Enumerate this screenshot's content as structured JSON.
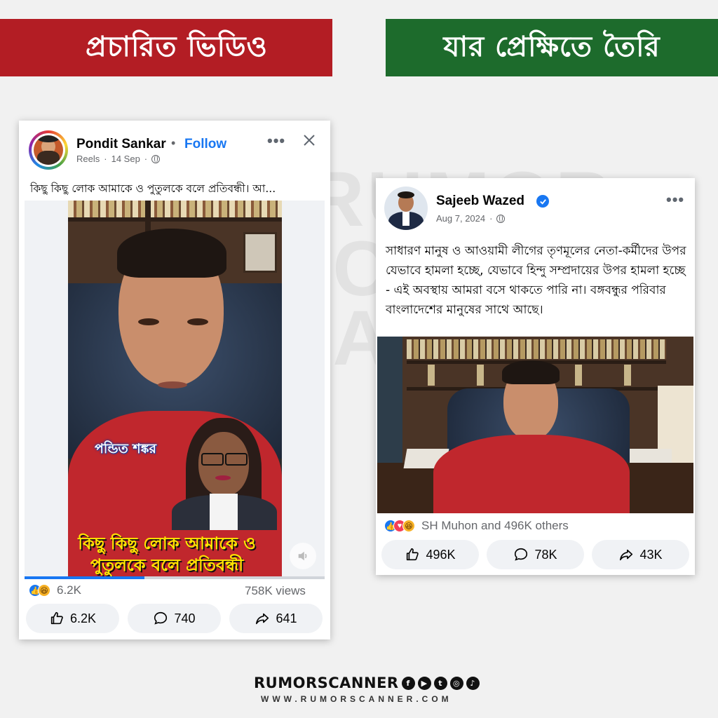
{
  "banners": {
    "left": "প্রচারিত ভিডিও",
    "right": "যার প্রেক্ষিতে তৈরি"
  },
  "watermark": "RUMOR CA AN",
  "left_post": {
    "author": "Pondit Sankar",
    "follow_separator": "•",
    "follow": "Follow",
    "meta_type": "Reels",
    "meta_date": "14 Sep",
    "caption": "কিছু কিছু লোক আমাকে ও পুতুলকে বলে প্রতিবন্ধী। আ...",
    "video_overlay_name": "পন্ডিত শঙ্কর",
    "video_subtitle": "কিছু কিছু লোক আমাকে ও পুতুলকে বলে প্রতিবন্ধী",
    "progress": 0.4,
    "reaction_count": "6.2K",
    "views": "758K views",
    "like_count": "6.2K",
    "comment_count": "740",
    "share_count": "641"
  },
  "right_post": {
    "author": "Sajeeb Wazed",
    "meta_date": "Aug 7, 2024",
    "caption": "সাধারণ মানুষ ও আওয়ামী লীগের তৃণমূলের নেতা-কর্মীদের উপর যেভাবে হামলা হচ্ছে, যেভাবে হিন্দু সম্প্রদায়ের উপর হামলা হচ্ছে - এই অবস্থায় আমরা বসে থাকতে পারি না। বঙ্গবন্ধুর পরিবার বাংলাদেশের মানুষের সাথে আছে।",
    "reactions_text": "SH Muhon and 496K others",
    "like_count": "496K",
    "comment_count": "78K",
    "share_count": "43K"
  },
  "footer": {
    "brand": "RUMORSCANNER",
    "url": "WWW.RUMORSCANNER.COM"
  },
  "colors": {
    "banner_red": "#b31d24",
    "banner_green": "#1d6b2c",
    "fb_blue": "#1877f2"
  }
}
